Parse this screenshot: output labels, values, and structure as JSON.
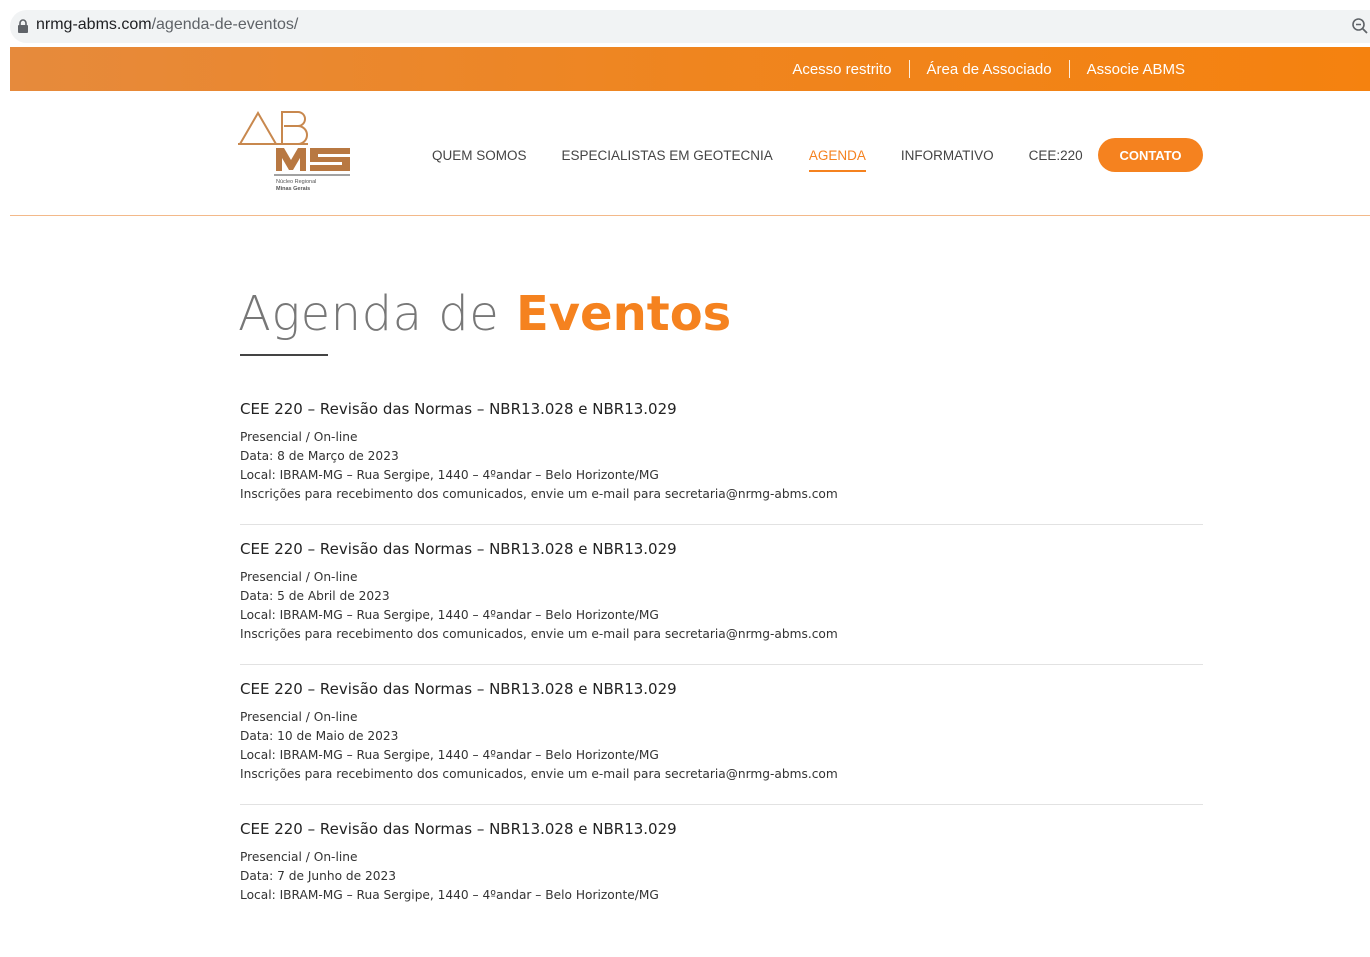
{
  "browser": {
    "url_domain": "nrmg-abms.com",
    "url_path": "/agenda-de-eventos/",
    "icons": [
      "lock-icon",
      "zoom-icon"
    ]
  },
  "topbar": {
    "links": [
      "Acesso restrito",
      "Área de Associado",
      "Associe ABMS"
    ],
    "color": "#f5821f"
  },
  "logo": {
    "caption_line1": "Núcleo Regional",
    "caption_line2": "Minas Gerais"
  },
  "nav": {
    "items": [
      "QUEM SOMOS",
      "ESPECIALISTAS EM GEOTECNIA",
      "AGENDA",
      "INFORMATIVO",
      "CEE:220"
    ],
    "active": "AGENDA",
    "cta": "CONTATO",
    "accent": "#f5821f"
  },
  "page": {
    "title_light": "Agenda de",
    "title_bold": "Eventos"
  },
  "events": [
    {
      "title": "CEE 220  – Revisão das Normas – NBR13.028 e NBR13.029",
      "mode": "Presencial / On-line",
      "date": "Data: 8 de Março de 2023",
      "location": "Local: IBRAM-MG – Rua Sergipe, 1440 – 4ºandar – Belo Horizonte/MG",
      "info": "Inscrições para recebimento dos comunicados, envie um e-mail para secretaria@nrmg-abms.com"
    },
    {
      "title": "CEE 220  – Revisão das Normas – NBR13.028 e NBR13.029",
      "mode": "Presencial / On-line",
      "date": "Data: 5 de Abril de 2023",
      "location": "Local: IBRAM-MG – Rua Sergipe, 1440 – 4ºandar – Belo Horizonte/MG",
      "info": "Inscrições para recebimento dos comunicados, envie um e-mail para secretaria@nrmg-abms.com"
    },
    {
      "title": "CEE 220  – Revisão das Normas – NBR13.028 e NBR13.029",
      "mode": "Presencial / On-line",
      "date": "Data: 10 de Maio de 2023",
      "location": "Local: IBRAM-MG – Rua Sergipe, 1440 – 4ºandar – Belo Horizonte/MG",
      "info": "Inscrições para recebimento dos comunicados, envie um e-mail para secretaria@nrmg-abms.com"
    },
    {
      "title": "CEE 220  – Revisão das Normas – NBR13.028 e NBR13.029",
      "mode": "Presencial / On-line",
      "date": "Data: 7 de Junho de 2023",
      "location": "Local: IBRAM-MG – Rua Sergipe, 1440 – 4ºandar – Belo Horizonte/MG",
      "info": ""
    }
  ]
}
